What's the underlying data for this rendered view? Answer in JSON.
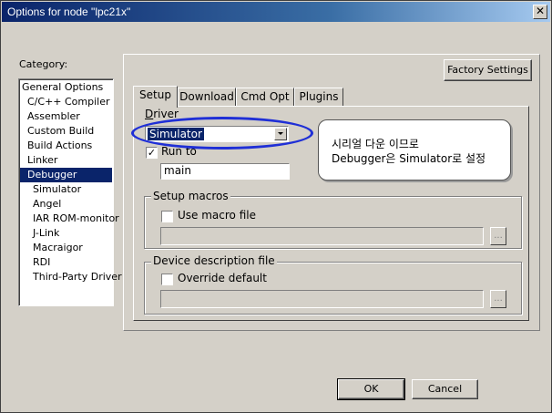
{
  "window": {
    "title": "Options for node \"lpc21x\"",
    "close_glyph": "✕"
  },
  "category": {
    "label": "Category:",
    "selected_index": 6,
    "items": [
      "General Options",
      "C/C++ Compiler",
      "Assembler",
      "Custom Build",
      "Build Actions",
      "Linker",
      "Debugger",
      "Simulator",
      "Angel",
      "IAR ROM-monitor",
      "J-Link",
      "Macraigor",
      "RDI",
      "Third-Party Driver"
    ]
  },
  "factory_settings_label": "Factory Settings",
  "tabs": [
    "Setup",
    "Download",
    "Cmd Opt",
    "Plugins"
  ],
  "setup": {
    "driver_label": "Driver",
    "driver_value": "Simulator",
    "run_to_label": "Run to",
    "run_to_checked": true,
    "run_to_value": "main",
    "setup_macros_title": "Setup macros",
    "use_macro_file_label": "Use macro file",
    "use_macro_file_checked": false,
    "macro_file_value": "",
    "device_description_title": "Device description file",
    "override_default_label": "Override default",
    "override_default_checked": false,
    "device_file_value": "",
    "browse_label": "..."
  },
  "annotation": {
    "line1": "시리얼 다운 이므로",
    "line2": "Debugger은 Simulator로 설정",
    "ellipse_color": "#1f2fd6"
  },
  "buttons": {
    "ok_label": "OK",
    "cancel_label": "Cancel"
  },
  "colors": {
    "selection": "#0a246a",
    "face": "#d4d0c8"
  }
}
